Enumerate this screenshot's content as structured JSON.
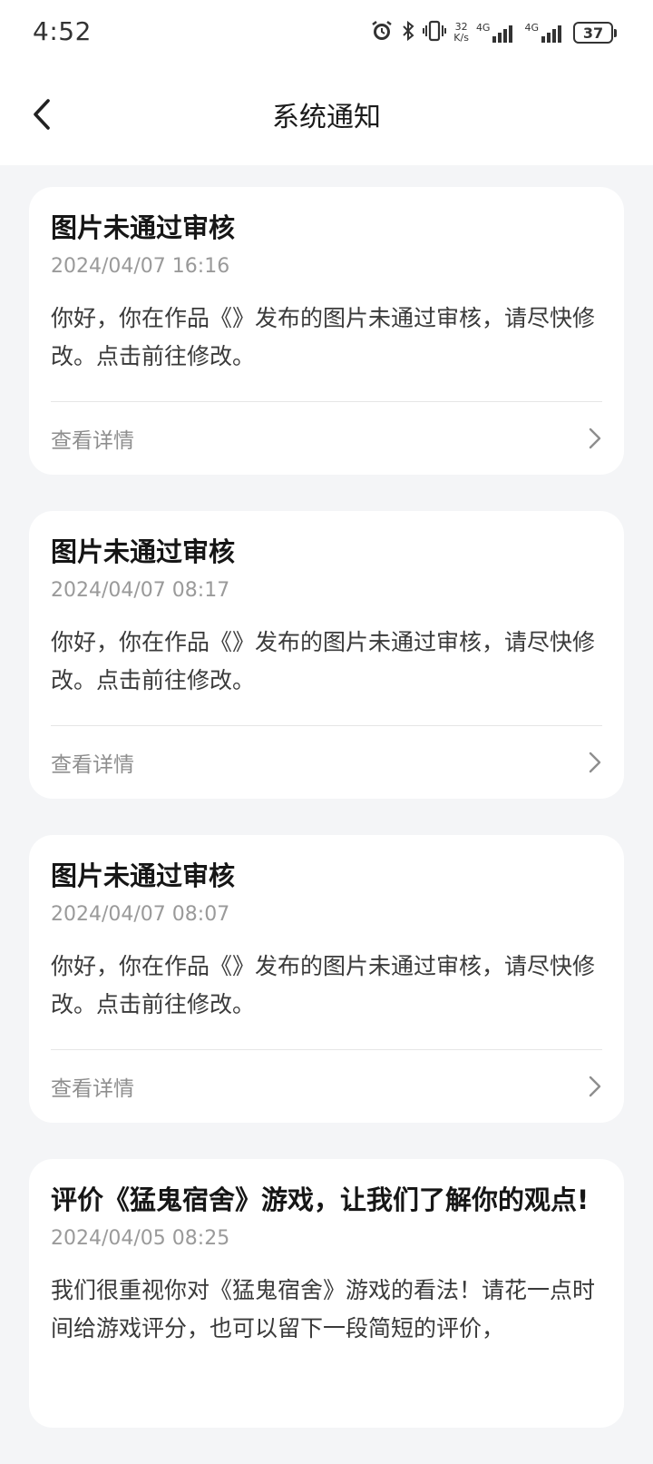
{
  "status_bar": {
    "time": "4:52",
    "speed_top": "32",
    "speed_bottom": "K/s",
    "network_1": "4G",
    "network_2": "4G",
    "battery": "37",
    "icons": [
      "alarm-icon",
      "bluetooth-icon",
      "vibrate-icon",
      "signal-icon",
      "battery-icon"
    ]
  },
  "header": {
    "title": "系统通知",
    "back_icon": "chevron-left-icon"
  },
  "notifications": [
    {
      "title": "图片未通过审核",
      "time": "2024/04/07 16:16",
      "body": "你好，你在作品《》发布的图片未通过审核，请尽快修改。点击前往修改。",
      "link": "查看详情"
    },
    {
      "title": "图片未通过审核",
      "time": "2024/04/07 08:17",
      "body": "你好，你在作品《》发布的图片未通过审核，请尽快修改。点击前往修改。",
      "link": "查看详情"
    },
    {
      "title": "图片未通过审核",
      "time": "2024/04/07 08:07",
      "body": "你好，你在作品《》发布的图片未通过审核，请尽快修改。点击前往修改。",
      "link": "查看详情"
    },
    {
      "title": "评价《猛鬼宿舍》游戏，让我们了解你的观点!",
      "time": "2024/04/05 08:25",
      "body": "我们很重视你对《猛鬼宿舍》游戏的看法！请花一点时间给游戏评分，也可以留下一段简短的评价，"
    }
  ]
}
